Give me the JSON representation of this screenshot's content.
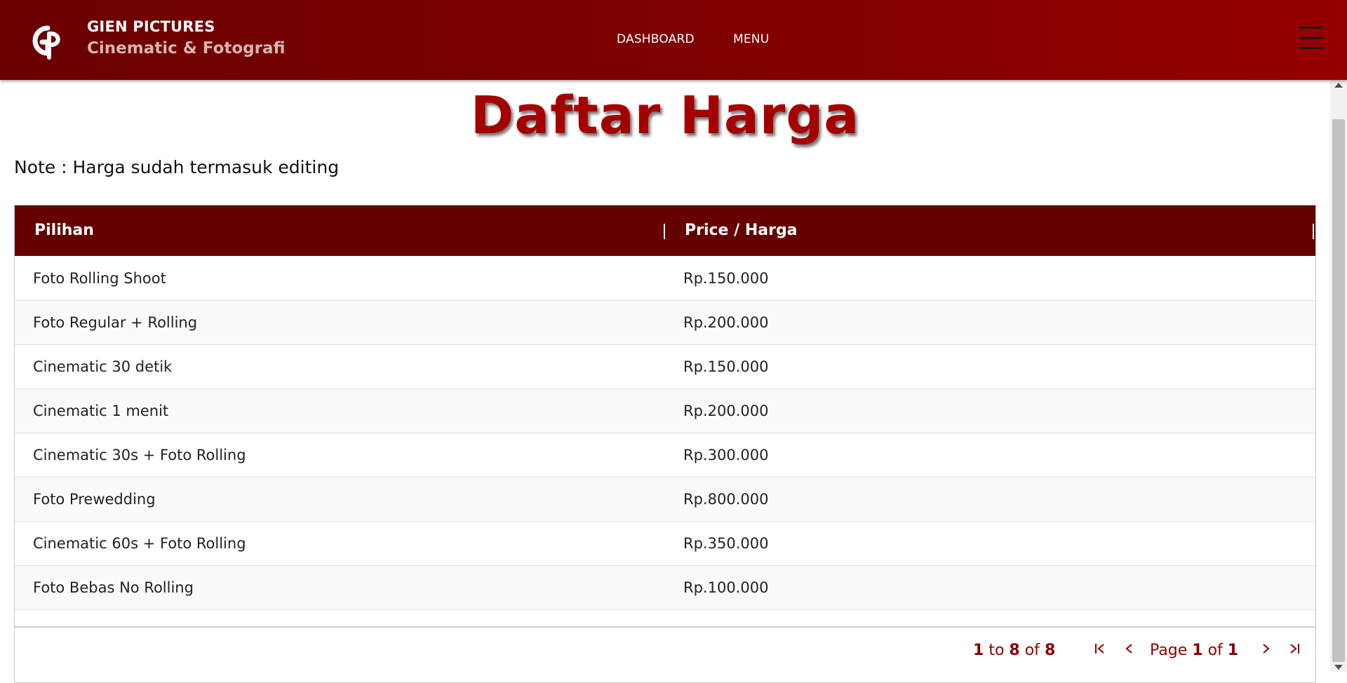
{
  "header": {
    "logo_icon": "gp-monogram-logo",
    "brand_title": "GIEN PICTURES",
    "brand_subtitle": "Cinematic & Fotografi",
    "nav": [
      {
        "label": "DASHBOARD"
      },
      {
        "label": "MENU"
      }
    ],
    "menu_icon": "hamburger-menu-icon"
  },
  "colors": {
    "brand_dark": "#650000",
    "brand_red": "#a50000",
    "accent_text": "#8a0000"
  },
  "page": {
    "title": "Daftar Harga",
    "note": "Note : Harga sudah termasuk editing"
  },
  "table": {
    "columns": [
      "Pilihan",
      "Price / Harga"
    ],
    "rows": [
      {
        "pilihan": "Foto Rolling Shoot",
        "harga": "Rp.150.000"
      },
      {
        "pilihan": "Foto Regular + Rolling",
        "harga": "Rp.200.000"
      },
      {
        "pilihan": "Cinematic 30 detik",
        "harga": "Rp.150.000"
      },
      {
        "pilihan": "Cinematic 1 menit",
        "harga": "Rp.200.000"
      },
      {
        "pilihan": "Cinematic 30s + Foto Rolling",
        "harga": "Rp.300.000"
      },
      {
        "pilihan": "Foto Prewedding",
        "harga": "Rp.800.000"
      },
      {
        "pilihan": "Cinematic 60s + Foto Rolling",
        "harga": "Rp.350.000"
      },
      {
        "pilihan": "Foto Bebas No Rolling",
        "harga": "Rp.100.000"
      }
    ]
  },
  "pagination": {
    "from": "1",
    "to_word": "to",
    "to": "8",
    "of_word": "of",
    "total": "8",
    "page_word": "Page",
    "current_page": "1",
    "total_pages": "1",
    "first_icon": "first-page-icon",
    "prev_icon": "previous-page-icon",
    "next_icon": "next-page-icon",
    "last_icon": "last-page-icon"
  }
}
